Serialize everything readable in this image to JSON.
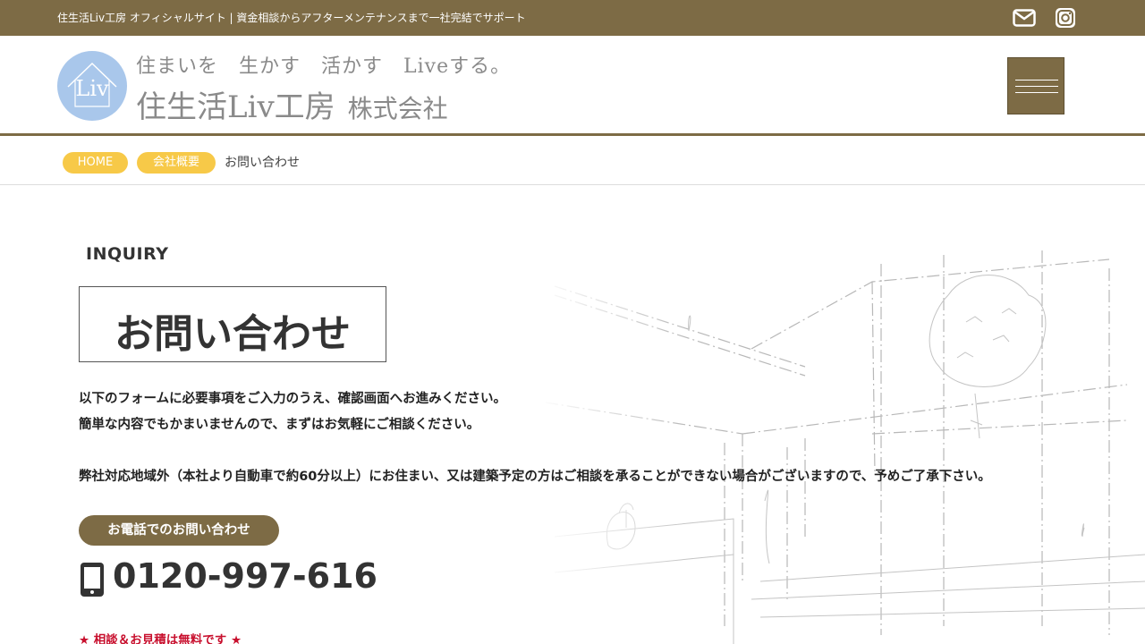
{
  "topbar": {
    "text": "住生活Liv工房 オフィシャルサイト | 資金相談からアフターメンテナンスまで一社完結でサポート"
  },
  "header": {
    "logo_text": "Liv",
    "tagline": "住まいを　生かす　活かす　Liveする。",
    "company_name": "住生活Liv工房",
    "company_suffix": "株式会社"
  },
  "breadcrumb": {
    "items": [
      {
        "label": "HOME"
      },
      {
        "label": "会社概要"
      }
    ],
    "current": "お問い合わせ"
  },
  "main": {
    "eyebrow": "INQUIRY",
    "title": "お問い合わせ",
    "paragraphs": [
      "以下のフォームに必要事項をご入力のうえ、確認画面へお進みください。",
      "簡単な内容でもかまいませんので、まずはお気軽にご相談ください。",
      "弊社対応地域外（本社より自動車で約60分以上）にお住まい、又は建築予定の方はご相談を承ることができない場合がございますので、予めご了承下さい。"
    ],
    "phone_label": "お電話でのお問い合わせ",
    "phone_number": "0120-997-616",
    "free_note": "★ 相談＆お見積は無料です ★"
  },
  "colors": {
    "brand": "#7d6b45",
    "accent": "#f7c948",
    "logo": "#a9c7eb",
    "notice": "#c8102e"
  },
  "icons": {
    "mail": "mail-icon",
    "instagram": "instagram-icon",
    "menu": "hamburger-menu-icon",
    "phone": "smartphone-icon"
  }
}
